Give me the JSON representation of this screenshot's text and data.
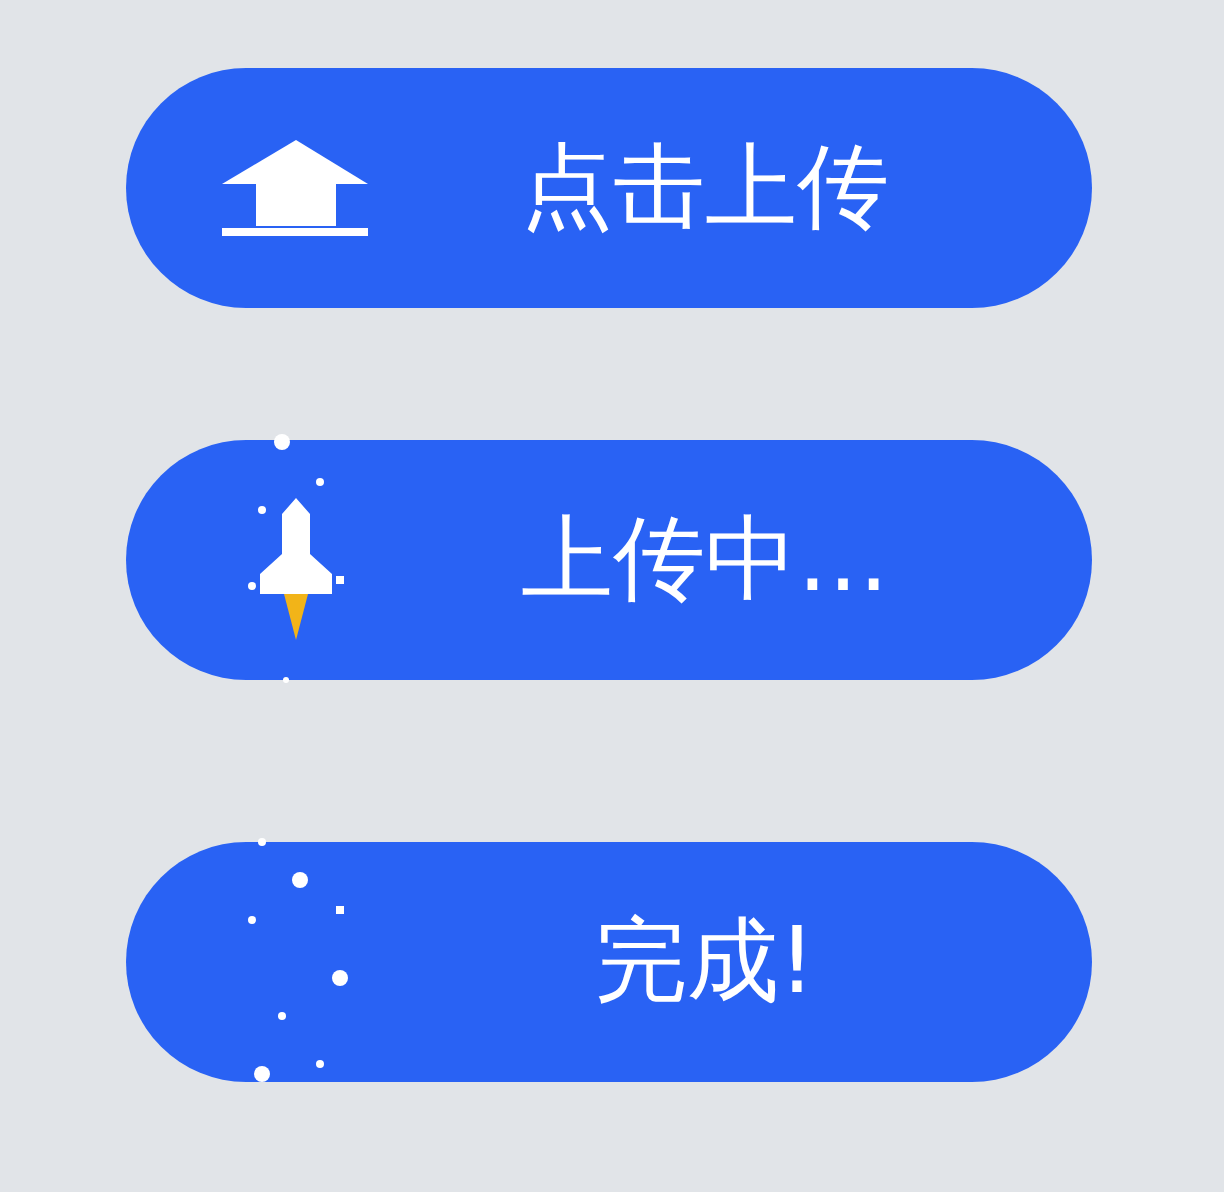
{
  "buttons": [
    {
      "kind": "upload",
      "label": "点击上传"
    },
    {
      "kind": "uploading",
      "label": "上传中…"
    },
    {
      "kind": "done",
      "label": "完成!"
    }
  ]
}
